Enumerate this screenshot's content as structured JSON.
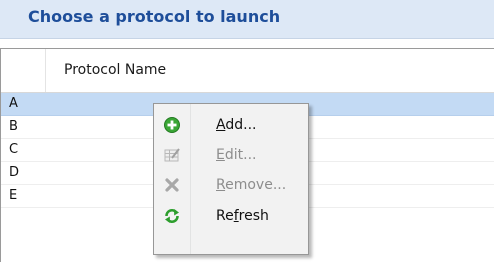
{
  "header": {
    "title": "Choose a protocol to launch"
  },
  "grid": {
    "column_header": "Protocol Name",
    "rows": [
      "A",
      "B",
      "C",
      "D",
      "E"
    ],
    "selected_row": "A"
  },
  "context_menu": {
    "items": [
      {
        "label": "Add...",
        "icon": "add-icon",
        "enabled": true
      },
      {
        "label": "Edit...",
        "icon": "edit-icon",
        "enabled": false
      },
      {
        "label": "Remove...",
        "icon": "remove-icon",
        "enabled": false
      },
      {
        "label": "Refresh",
        "icon": "refresh-icon",
        "enabled": true
      }
    ]
  },
  "colors": {
    "title_text": "#1e4e9a",
    "title_bar_bg": "#dde8f6",
    "selection_bg": "#c3daf4",
    "add_icon": "#3aa635",
    "refresh_icon": "#2d9e2d",
    "disabled_text": "#8d8d8d"
  }
}
